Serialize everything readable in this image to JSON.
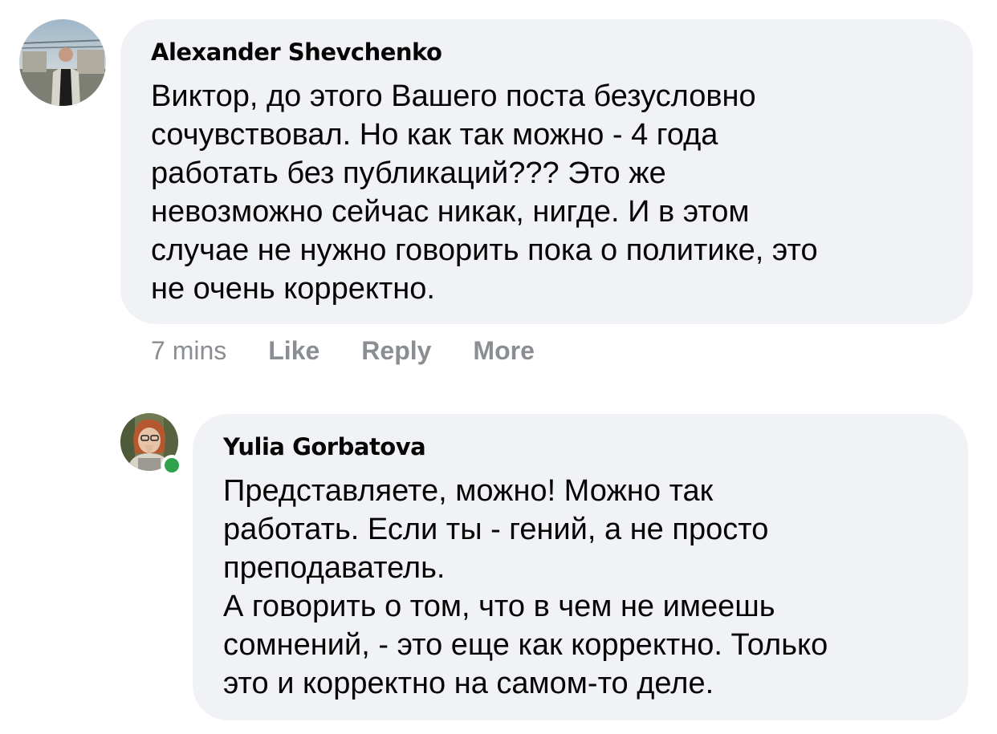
{
  "comments": [
    {
      "author": "Alexander Shevchenko",
      "avatar_icon": "user-photo-avatar",
      "lines": [
        "Виктор, до этого Вашего поста безусловно",
        "сочувствовал. Но как так можно - 4 года",
        "работать без публикаций??? Это же",
        "невозможно сейчас никак, нигде. И в этом",
        "случае не нужно говорить пока о политике, это",
        "не очень корректно."
      ],
      "time": "7 mins",
      "like_label": "Like",
      "reply_label": "Reply",
      "more_label": "More"
    },
    {
      "author": "Yulia Gorbatova",
      "avatar_icon": "user-photo-avatar",
      "online": true,
      "lines": [
        "Представляете, можно! Можно так",
        "работать. Если ты - гений, а не просто",
        "преподаватель.",
        "А говорить о том, что в чем не имеешь",
        "сомнений, - это еще как корректно. Только",
        "это и корректно на самом-то деле."
      ]
    }
  ],
  "colors": {
    "bubble": "#f0f2f5",
    "text": "#050505",
    "meta": "#8a8d91",
    "online": "#31a24c"
  }
}
